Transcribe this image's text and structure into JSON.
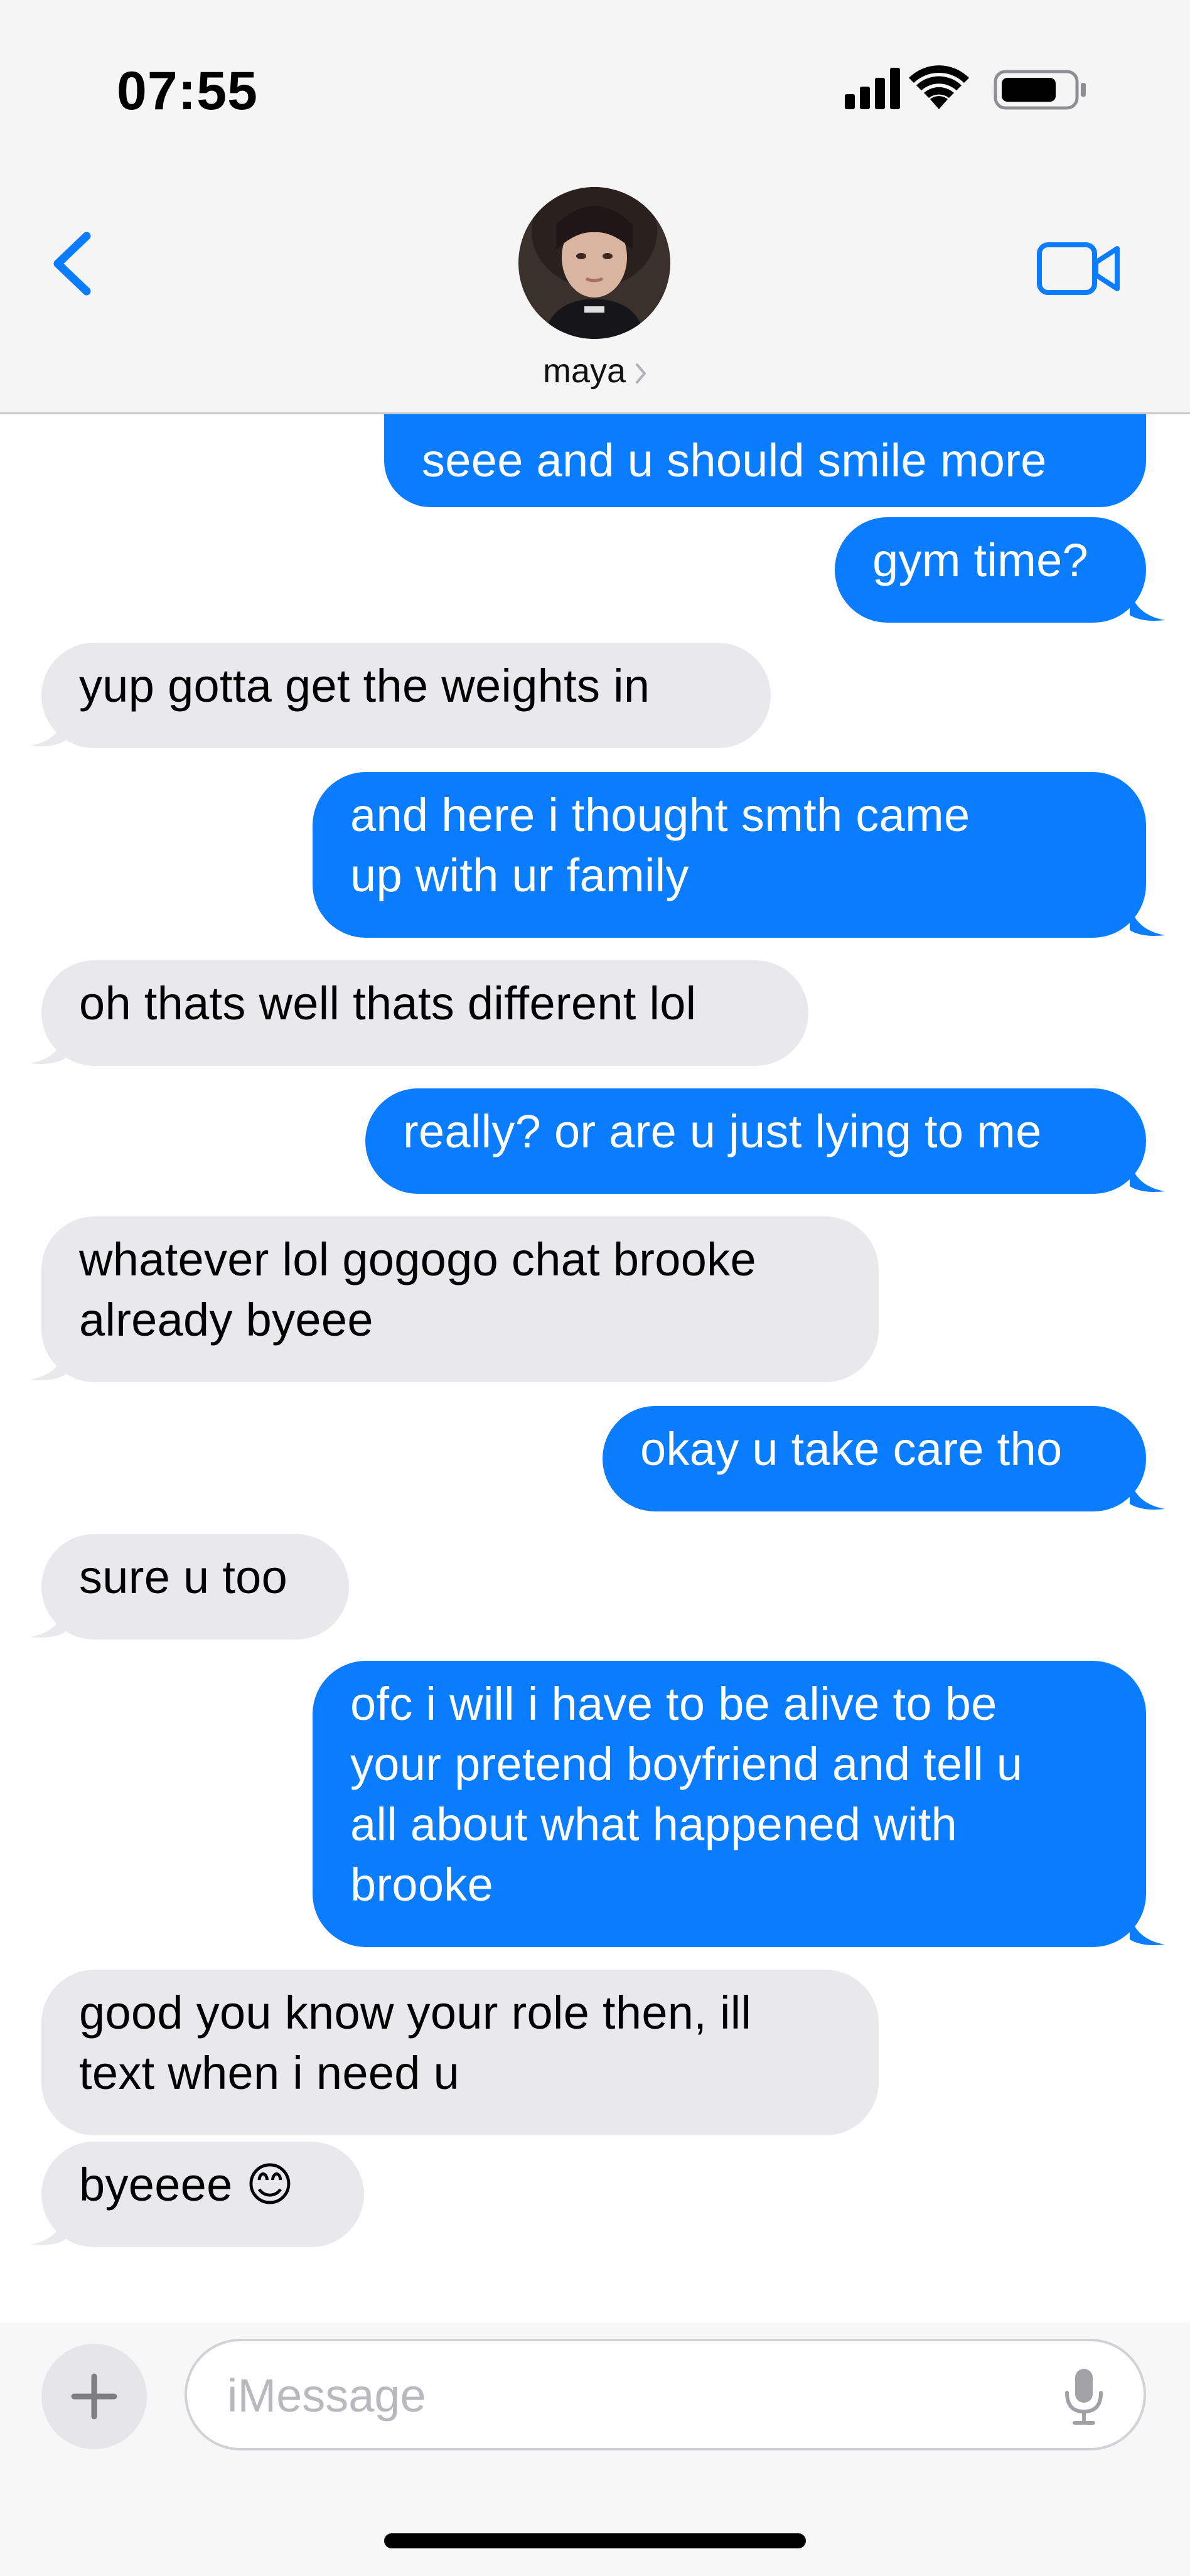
{
  "status_bar": {
    "time": "07:55",
    "icons": [
      "cellular-signal-icon",
      "wifi-icon",
      "battery-icon"
    ]
  },
  "header": {
    "back_icon": "chevron-left-icon",
    "contact_name": "maya",
    "contact_chevron_icon": "chevron-right-icon",
    "video_icon": "video-camera-icon"
  },
  "messages": [
    {
      "from": "me",
      "text": "seee and u should smile more"
    },
    {
      "from": "me",
      "text": "gym time?"
    },
    {
      "from": "them",
      "text": "yup gotta get the weights in"
    },
    {
      "from": "me",
      "text": "and here i thought smth came\nup with ur family"
    },
    {
      "from": "them",
      "text": "oh thats well thats different lol"
    },
    {
      "from": "me",
      "text": "really? or are u just lying to me"
    },
    {
      "from": "them",
      "text": "whatever lol gogogo chat brooke\nalready byeee"
    },
    {
      "from": "me",
      "text": "okay u take care tho"
    },
    {
      "from": "them",
      "text": "sure u too"
    },
    {
      "from": "me",
      "text": "ofc i will i have to be alive to be\nyour pretend boyfriend and tell u\nall about what happened with\nbrooke"
    },
    {
      "from": "them",
      "text": "good you know your role then, ill\ntext when i need u"
    },
    {
      "from": "them",
      "text": "byeeee 😊"
    }
  ],
  "composer": {
    "plus_icon": "plus-icon",
    "placeholder": "iMessage",
    "value": "",
    "mic_icon": "microphone-icon"
  },
  "colors": {
    "outgoing_bubble": "#0a7cff",
    "incoming_bubble": "#e9e9eb",
    "accent": "#0a7cff",
    "header_bg": "#f5f5f6"
  }
}
